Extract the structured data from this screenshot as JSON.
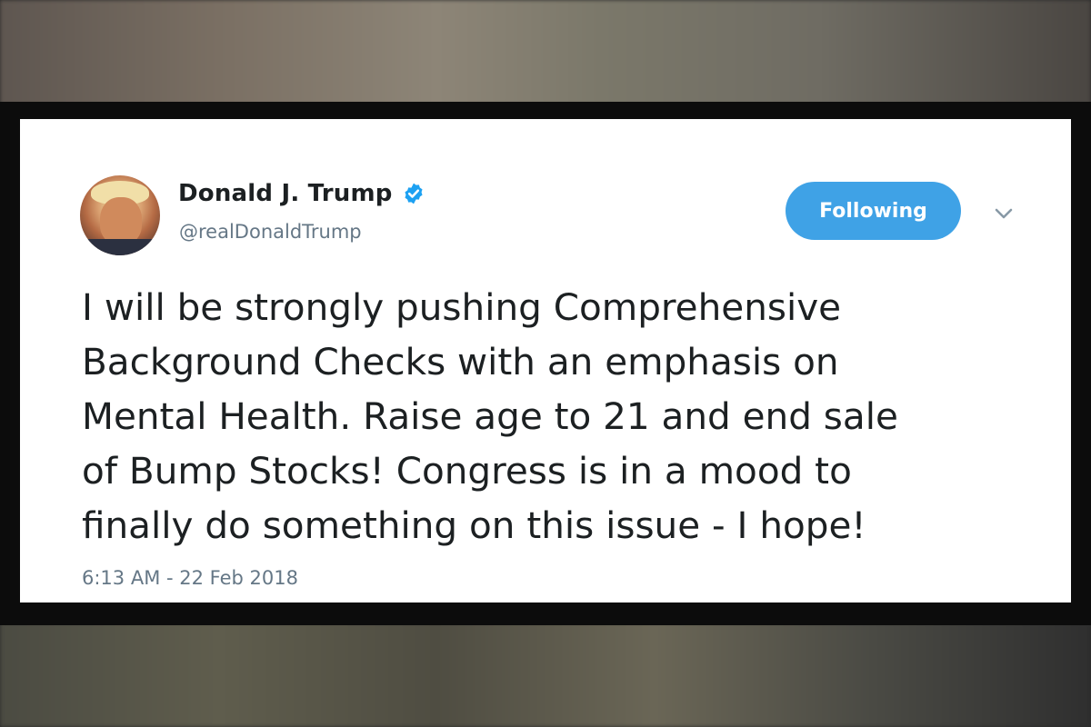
{
  "tweet": {
    "author_name": "Donald J. Trump",
    "author_handle": "@realDonaldTrump",
    "verified_icon": "verified-badge-icon",
    "follow_button_label": "Following",
    "menu_icon": "chevron-down-icon",
    "text_lines": [
      "I will be strongly pushing Comprehensive",
      "Background Checks with an emphasis on",
      "Mental Health. Raise age to 21 and end sale",
      "of Bump Stocks! Congress is in a mood to",
      "finally do something on this issue - I hope!"
    ],
    "timestamp": "6:13 AM - 22 Feb 2018"
  },
  "colors": {
    "accent": "#3fa2e6",
    "text": "#1c2022",
    "secondary_text": "#657786",
    "verified": "#1da1f2"
  }
}
